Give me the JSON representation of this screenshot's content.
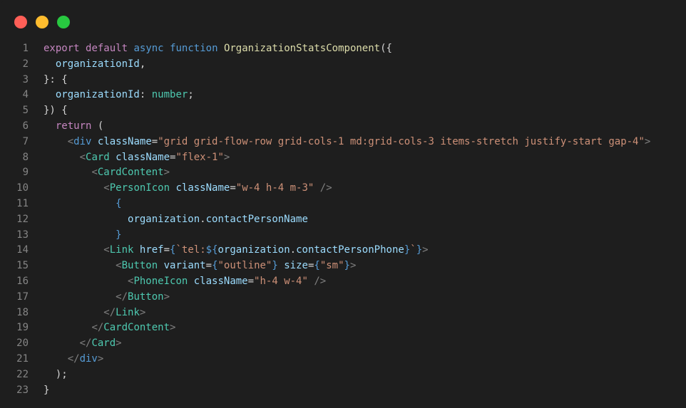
{
  "window": {
    "colors": {
      "background": "#1e1e1e",
      "close": "#ff5f57",
      "minimize": "#febc2e",
      "maximize": "#28c840",
      "line_number": "#858585"
    }
  },
  "lines": [
    {
      "n": "1",
      "tokens": [
        {
          "c": "kw",
          "t": "export"
        },
        {
          "c": "plain",
          "t": " "
        },
        {
          "c": "kw",
          "t": "default"
        },
        {
          "c": "plain",
          "t": " "
        },
        {
          "c": "kwb",
          "t": "async"
        },
        {
          "c": "plain",
          "t": " "
        },
        {
          "c": "kwb",
          "t": "function"
        },
        {
          "c": "plain",
          "t": " "
        },
        {
          "c": "fn",
          "t": "OrganizationStatsComponent"
        },
        {
          "c": "plain",
          "t": "({"
        }
      ]
    },
    {
      "n": "2",
      "tokens": [
        {
          "c": "plain",
          "t": "  "
        },
        {
          "c": "var",
          "t": "organizationId"
        },
        {
          "c": "plain",
          "t": ","
        }
      ]
    },
    {
      "n": "3",
      "tokens": [
        {
          "c": "plain",
          "t": "}: {"
        }
      ]
    },
    {
      "n": "4",
      "tokens": [
        {
          "c": "plain",
          "t": "  "
        },
        {
          "c": "var",
          "t": "organizationId"
        },
        {
          "c": "plain",
          "t": ": "
        },
        {
          "c": "typ",
          "t": "number"
        },
        {
          "c": "plain",
          "t": ";"
        }
      ]
    },
    {
      "n": "5",
      "tokens": [
        {
          "c": "plain",
          "t": "}) {"
        }
      ]
    },
    {
      "n": "6",
      "tokens": [
        {
          "c": "plain",
          "t": "  "
        },
        {
          "c": "kw",
          "t": "return"
        },
        {
          "c": "plain",
          "t": " ("
        }
      ]
    },
    {
      "n": "7",
      "tokens": [
        {
          "c": "plain",
          "t": "    "
        },
        {
          "c": "punc-tag",
          "t": "<"
        },
        {
          "c": "kwb",
          "t": "div"
        },
        {
          "c": "plain",
          "t": " "
        },
        {
          "c": "attr",
          "t": "className"
        },
        {
          "c": "plain",
          "t": "="
        },
        {
          "c": "str",
          "t": "\"grid grid-flow-row grid-cols-1 md:grid-cols-3 items-stretch justify-start gap-4\""
        },
        {
          "c": "punc-tag",
          "t": ">"
        }
      ]
    },
    {
      "n": "8",
      "tokens": [
        {
          "c": "plain",
          "t": "      "
        },
        {
          "c": "punc-tag",
          "t": "<"
        },
        {
          "c": "tag",
          "t": "Card"
        },
        {
          "c": "plain",
          "t": " "
        },
        {
          "c": "attr",
          "t": "className"
        },
        {
          "c": "plain",
          "t": "="
        },
        {
          "c": "str",
          "t": "\"flex-1\""
        },
        {
          "c": "punc-tag",
          "t": ">"
        }
      ]
    },
    {
      "n": "9",
      "tokens": [
        {
          "c": "plain",
          "t": "        "
        },
        {
          "c": "punc-tag",
          "t": "<"
        },
        {
          "c": "tag",
          "t": "CardContent"
        },
        {
          "c": "punc-tag",
          "t": ">"
        }
      ]
    },
    {
      "n": "10",
      "tokens": [
        {
          "c": "plain",
          "t": "          "
        },
        {
          "c": "punc-tag",
          "t": "<"
        },
        {
          "c": "tag",
          "t": "PersonIcon"
        },
        {
          "c": "plain",
          "t": " "
        },
        {
          "c": "attr",
          "t": "className"
        },
        {
          "c": "plain",
          "t": "="
        },
        {
          "c": "str",
          "t": "\"w-4 h-4 m-3\""
        },
        {
          "c": "plain",
          "t": " "
        },
        {
          "c": "punc-tag",
          "t": "/>"
        }
      ]
    },
    {
      "n": "11",
      "tokens": [
        {
          "c": "plain",
          "t": "            "
        },
        {
          "c": "brace",
          "t": "{"
        }
      ]
    },
    {
      "n": "12",
      "tokens": [
        {
          "c": "plain",
          "t": "              "
        },
        {
          "c": "var",
          "t": "organization"
        },
        {
          "c": "plain",
          "t": "."
        },
        {
          "c": "var",
          "t": "contactPersonName"
        }
      ]
    },
    {
      "n": "13",
      "tokens": [
        {
          "c": "plain",
          "t": "            "
        },
        {
          "c": "brace",
          "t": "}"
        }
      ]
    },
    {
      "n": "14",
      "tokens": [
        {
          "c": "plain",
          "t": "          "
        },
        {
          "c": "punc-tag",
          "t": "<"
        },
        {
          "c": "tag",
          "t": "Link"
        },
        {
          "c": "plain",
          "t": " "
        },
        {
          "c": "attr",
          "t": "href"
        },
        {
          "c": "plain",
          "t": "="
        },
        {
          "c": "brace",
          "t": "{"
        },
        {
          "c": "str",
          "t": "`tel:"
        },
        {
          "c": "brace",
          "t": "${"
        },
        {
          "c": "var",
          "t": "organization"
        },
        {
          "c": "plain",
          "t": "."
        },
        {
          "c": "var",
          "t": "contactPersonPhone"
        },
        {
          "c": "brace",
          "t": "}"
        },
        {
          "c": "str",
          "t": "`"
        },
        {
          "c": "brace",
          "t": "}"
        },
        {
          "c": "punc-tag",
          "t": ">"
        }
      ]
    },
    {
      "n": "15",
      "tokens": [
        {
          "c": "plain",
          "t": "            "
        },
        {
          "c": "punc-tag",
          "t": "<"
        },
        {
          "c": "tag",
          "t": "Button"
        },
        {
          "c": "plain",
          "t": " "
        },
        {
          "c": "attr",
          "t": "variant"
        },
        {
          "c": "plain",
          "t": "="
        },
        {
          "c": "brace",
          "t": "{"
        },
        {
          "c": "str",
          "t": "\"outline\""
        },
        {
          "c": "brace",
          "t": "}"
        },
        {
          "c": "plain",
          "t": " "
        },
        {
          "c": "attr",
          "t": "size"
        },
        {
          "c": "plain",
          "t": "="
        },
        {
          "c": "brace",
          "t": "{"
        },
        {
          "c": "str",
          "t": "\"sm\""
        },
        {
          "c": "brace",
          "t": "}"
        },
        {
          "c": "punc-tag",
          "t": ">"
        }
      ]
    },
    {
      "n": "16",
      "tokens": [
        {
          "c": "plain",
          "t": "              "
        },
        {
          "c": "punc-tag",
          "t": "<"
        },
        {
          "c": "tag",
          "t": "PhoneIcon"
        },
        {
          "c": "plain",
          "t": " "
        },
        {
          "c": "attr",
          "t": "className"
        },
        {
          "c": "plain",
          "t": "="
        },
        {
          "c": "str",
          "t": "\"h-4 w-4\""
        },
        {
          "c": "plain",
          "t": " "
        },
        {
          "c": "punc-tag",
          "t": "/>"
        }
      ]
    },
    {
      "n": "17",
      "tokens": [
        {
          "c": "plain",
          "t": "            "
        },
        {
          "c": "punc-tag",
          "t": "</"
        },
        {
          "c": "tag",
          "t": "Button"
        },
        {
          "c": "punc-tag",
          "t": ">"
        }
      ]
    },
    {
      "n": "18",
      "tokens": [
        {
          "c": "plain",
          "t": "          "
        },
        {
          "c": "punc-tag",
          "t": "</"
        },
        {
          "c": "tag",
          "t": "Link"
        },
        {
          "c": "punc-tag",
          "t": ">"
        }
      ]
    },
    {
      "n": "19",
      "tokens": [
        {
          "c": "plain",
          "t": "        "
        },
        {
          "c": "punc-tag",
          "t": "</"
        },
        {
          "c": "tag",
          "t": "CardContent"
        },
        {
          "c": "punc-tag",
          "t": ">"
        }
      ]
    },
    {
      "n": "20",
      "tokens": [
        {
          "c": "plain",
          "t": "      "
        },
        {
          "c": "punc-tag",
          "t": "</"
        },
        {
          "c": "tag",
          "t": "Card"
        },
        {
          "c": "punc-tag",
          "t": ">"
        }
      ]
    },
    {
      "n": "21",
      "tokens": [
        {
          "c": "plain",
          "t": "    "
        },
        {
          "c": "punc-tag",
          "t": "</"
        },
        {
          "c": "kwb",
          "t": "div"
        },
        {
          "c": "punc-tag",
          "t": ">"
        }
      ]
    },
    {
      "n": "22",
      "tokens": [
        {
          "c": "plain",
          "t": "  );"
        }
      ]
    },
    {
      "n": "23",
      "tokens": [
        {
          "c": "plain",
          "t": "}"
        }
      ]
    }
  ]
}
